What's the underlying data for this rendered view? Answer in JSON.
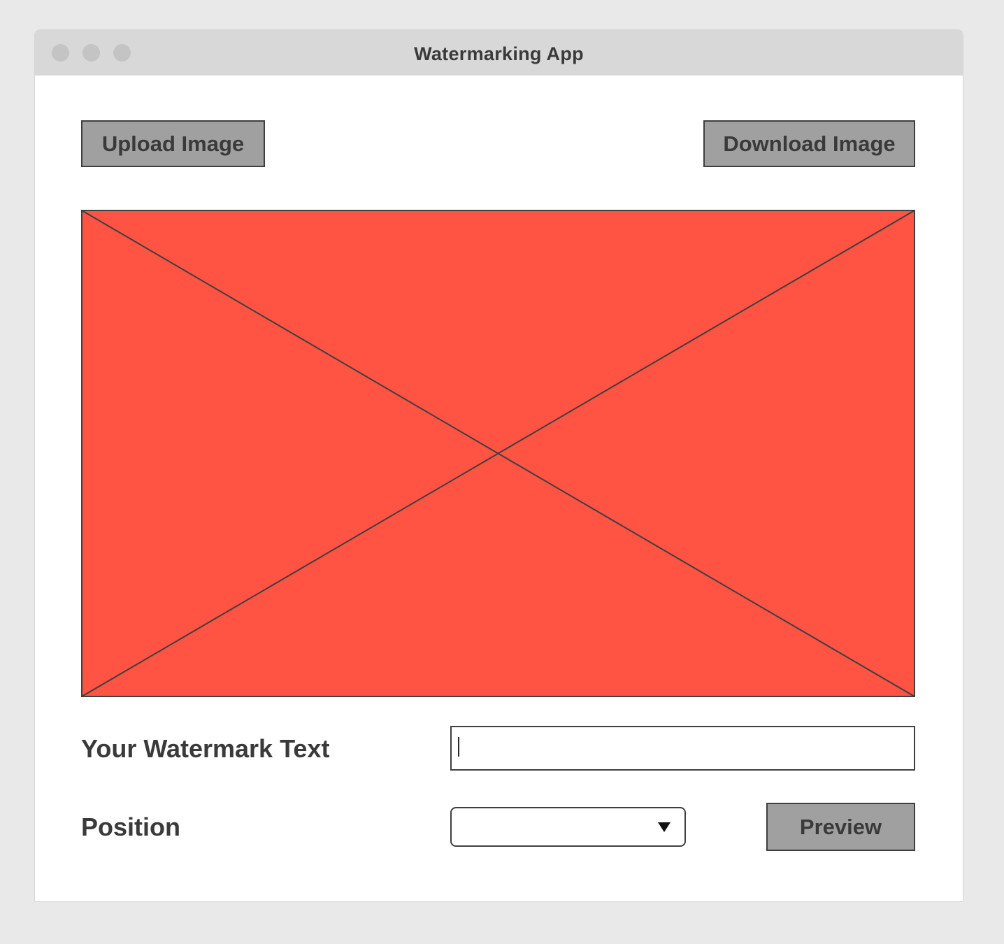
{
  "window": {
    "title": "Watermarking App"
  },
  "toolbar": {
    "upload_label": "Upload Image",
    "download_label": "Download Image"
  },
  "image_placeholder": {
    "fill_color": "#ff5343",
    "stroke_color": "#3f3f3f"
  },
  "watermark": {
    "label": "Your Watermark Text",
    "value": "",
    "placeholder": ""
  },
  "position": {
    "label": "Position",
    "selected": ""
  },
  "preview_label": "Preview",
  "colors": {
    "button_bg": "#a0a0a0",
    "titlebar_bg": "#d8d8d8",
    "text": "#3a3a3a"
  },
  "icons": {
    "dropdown": "chevron-down-icon",
    "window_controls": [
      "close-dot-icon",
      "minimize-dot-icon",
      "maximize-dot-icon"
    ]
  }
}
